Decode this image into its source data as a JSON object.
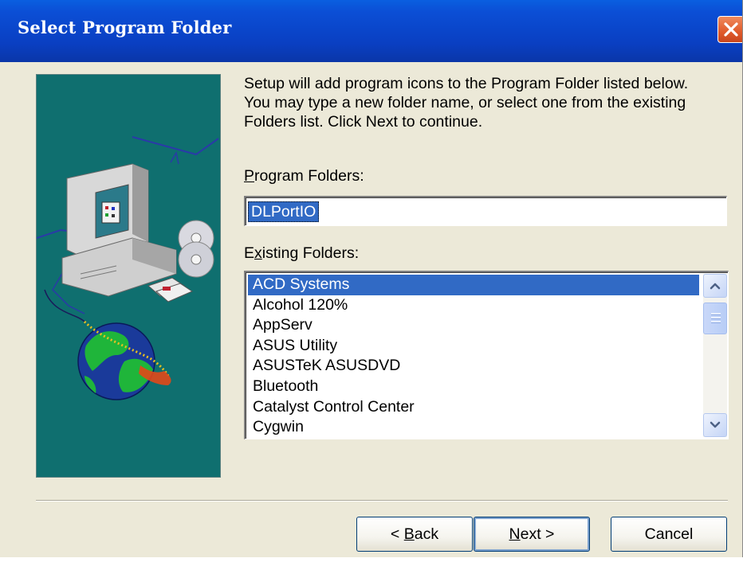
{
  "window": {
    "title": "Select Program Folder",
    "close_icon": "close-icon"
  },
  "content": {
    "description": "Setup will add program icons to the Program Folder listed below.\nYou may type a new folder name, or select one from the existing\nFolders list.  Click Next to continue.",
    "program_folders_label_accel": "P",
    "program_folders_label_rest": "rogram Folders:",
    "program_folder_value": "DLPortIO",
    "existing_folders_label_pre": "E",
    "existing_folders_label_accel": "x",
    "existing_folders_label_rest": "isting Folders:",
    "existing_folders": [
      "ACD Systems",
      "Alcohol 120%",
      "AppServ",
      "ASUS Utility",
      "ASUSTeK ASUSDVD",
      "Bluetooth",
      "Catalyst Control Center",
      "Cygwin"
    ],
    "selected_folder_index": 0,
    "list_scroll_position_fraction": 0.0
  },
  "buttons": {
    "back_prefix": "< ",
    "back_accel": "B",
    "back_rest": "ack",
    "next_accel": "N",
    "next_rest": "ext >",
    "cancel_label": "Cancel"
  },
  "colors": {
    "titlebar": "#0a3fc2",
    "selection": "#316ac5",
    "side_image_background": "#0f6f6f",
    "dialog_background": "#ece9d8"
  },
  "icons": {
    "side_illustration": "computer-with-cds-and-globe",
    "scroll_up": "chevron-up-icon",
    "scroll_down": "chevron-down-icon"
  }
}
